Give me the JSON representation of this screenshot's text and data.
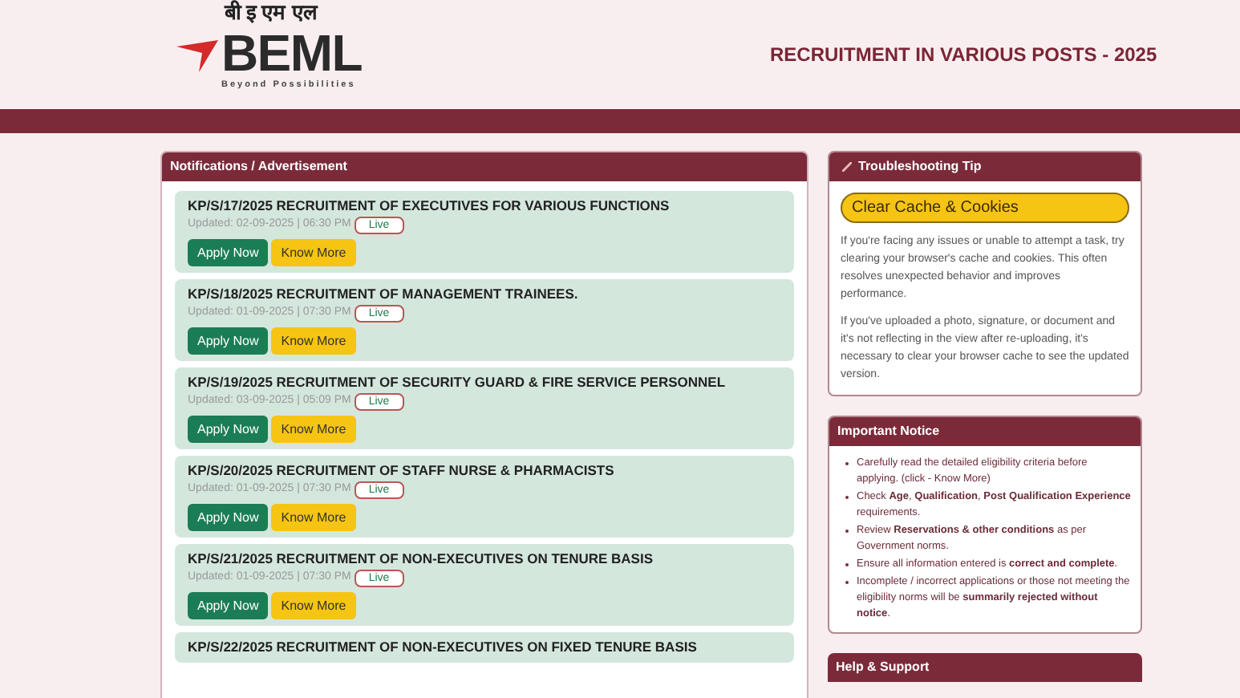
{
  "header": {
    "logo_hindi": "बी इ एम एल",
    "logo_name": "BEML",
    "logo_tagline": "Beyond Possibilities",
    "title": "RECRUITMENT IN VARIOUS POSTS - 2025"
  },
  "notifications": {
    "title": "Notifications / Advertisement",
    "items": [
      {
        "title": "KP/S/17/2025 RECRUITMENT OF EXECUTIVES FOR VARIOUS FUNCTIONS",
        "updated": "Updated: 02-09-2025 | 06:30 PM",
        "status": "Live",
        "apply": "Apply Now",
        "more": "Know More"
      },
      {
        "title": "KP/S/18/2025 RECRUITMENT OF MANAGEMENT TRAINEES.",
        "updated": "Updated: 01-09-2025 | 07:30 PM",
        "status": "Live",
        "apply": "Apply Now",
        "more": "Know More"
      },
      {
        "title": "KP/S/19/2025 RECRUITMENT OF SECURITY GUARD & FIRE SERVICE PERSONNEL",
        "updated": "Updated: 03-09-2025 | 05:09 PM",
        "status": "Live",
        "apply": "Apply Now",
        "more": "Know More"
      },
      {
        "title": "KP/S/20/2025 RECRUITMENT OF STAFF NURSE & PHARMACISTS",
        "updated": "Updated: 01-09-2025 | 07:30 PM",
        "status": "Live",
        "apply": "Apply Now",
        "more": "Know More"
      },
      {
        "title": "KP/S/21/2025 RECRUITMENT OF NON-EXECUTIVES ON TENURE BASIS",
        "updated": "Updated: 01-09-2025 | 07:30 PM",
        "status": "Live",
        "apply": "Apply Now",
        "more": "Know More"
      },
      {
        "title": "KP/S/22/2025 RECRUITMENT OF NON-EXECUTIVES ON FIXED TENURE BASIS"
      }
    ]
  },
  "tip": {
    "title": "Troubleshooting Tip",
    "button": "Clear Cache & Cookies",
    "paragraphs": [
      "If you're facing any issues or unable to attempt a task, try clearing your browser's cache and cookies. This often resolves unexpected behavior and improves performance.",
      "If you've uploaded a photo, signature, or document and it's not reflecting in the view after re-uploading, it's necessary to clear your browser cache to see the updated version."
    ]
  },
  "notice": {
    "title": "Important Notice",
    "items": [
      "Carefully read the detailed eligibility criteria before applying. (click - Know More)",
      "Check **Age**, **Qualification**, **Post Qualification Experience** requirements.",
      "Review **Reservations & other conditions** as per Government norms.",
      "Ensure all information entered is **correct and complete**.",
      "Incomplete / incorrect applications or those not meeting the eligibility norms will be **summarily rejected without notice**."
    ]
  },
  "help": {
    "title": "Help & Support"
  }
}
